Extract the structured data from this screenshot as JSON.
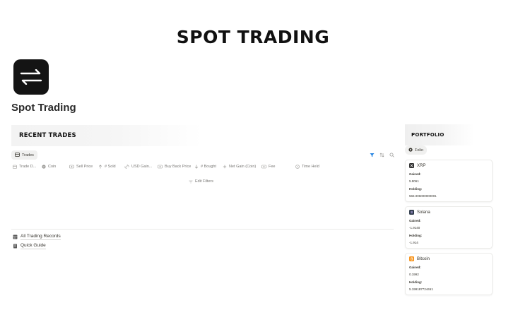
{
  "banner": {
    "title": "SPOT TRADING"
  },
  "page": {
    "title": "Spot Trading",
    "icon": "arrows-swap-icon"
  },
  "recent_trades": {
    "heading": "RECENT TRADES",
    "view_tab": {
      "label": "Trades",
      "icon": "table-view-icon"
    },
    "toolbar_icons": [
      "filter-icon",
      "sort-icon",
      "search-icon"
    ],
    "columns": [
      {
        "label": "Trade D...",
        "icon": "calendar-icon"
      },
      {
        "label": "Coin",
        "icon": "select-circle-icon"
      },
      {
        "label": "Sell Price",
        "icon": "currency-icon"
      },
      {
        "label": "# Sold",
        "icon": "arrow-up-icon"
      },
      {
        "label": "USD Gain...",
        "icon": "link-relation-icon"
      },
      {
        "label": "Buy Back Price",
        "icon": "currency-icon"
      },
      {
        "label": "# Bought",
        "icon": "arrow-down-icon"
      },
      {
        "label": "Net Gain (Coin)",
        "icon": "sigma-icon"
      },
      {
        "label": "Fee",
        "icon": "currency-icon"
      },
      {
        "label": "Time Held",
        "icon": "clock-icon"
      }
    ],
    "edit_filters": "Edit Filters"
  },
  "links": [
    {
      "label": "All Trading Records",
      "icon": "database-icon"
    },
    {
      "label": "Quick Guide",
      "icon": "book-icon"
    }
  ],
  "portfolio": {
    "heading": "PORTFOLIO",
    "view_tab": {
      "label": "Folio",
      "icon": "target-icon"
    },
    "cards": [
      {
        "name": "XRP",
        "icon_color": "#2f2f2f",
        "gained_label": "Gained:",
        "gained": "5.9061",
        "holding_label": "Holding:",
        "holding": "565.906000000001"
      },
      {
        "name": "Solana",
        "icon_color": "#2f3a4a",
        "gained_label": "Gained:",
        "gained": "-1.9140",
        "holding_label": "Holding:",
        "holding": "-1.914"
      },
      {
        "name": "Bitcoin",
        "icon_color": "#f7931a",
        "gained_label": "Gained:",
        "gained": "0.1992",
        "holding_label": "Holding:",
        "holding": "5.199187724461"
      }
    ]
  }
}
